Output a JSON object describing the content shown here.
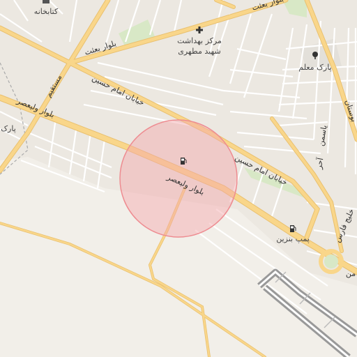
{
  "labels": {
    "library": "کتابخانه",
    "clinic_line1": "مرکز بهداشت",
    "clinic_line2": "شهید مطهری",
    "park_moalem": "پارک معلم",
    "park_west": "پارک",
    "gas_station": "پمپ بنزین"
  },
  "roads": {
    "besat_top": "بلوار بعثت",
    "besat_mid": "بلوار بعثت",
    "imam_hossein_upper": "خیابان امام حسین",
    "imam_hossein_lower": "خیابان امام حسین",
    "valiasr_west": "بلوار ولیعصر",
    "valiasr_center": "بلوار ولیعصر",
    "mostaghim": "مستقیم",
    "bostan": "بوستان",
    "yasaman": "یاسمن",
    "asr": "آحر",
    "faris": "خلیج فارس",
    "mo": "من"
  },
  "highlight": {
    "color": "#f4a6aa",
    "stroke": "#ee8c91"
  },
  "colors": {
    "background": "#f2efe9",
    "major_road": "#f9d68a",
    "major_road_casing": "#e9c06f",
    "minor_road": "#ffffff",
    "park": "#d8e8c6",
    "runway": "#999999"
  }
}
